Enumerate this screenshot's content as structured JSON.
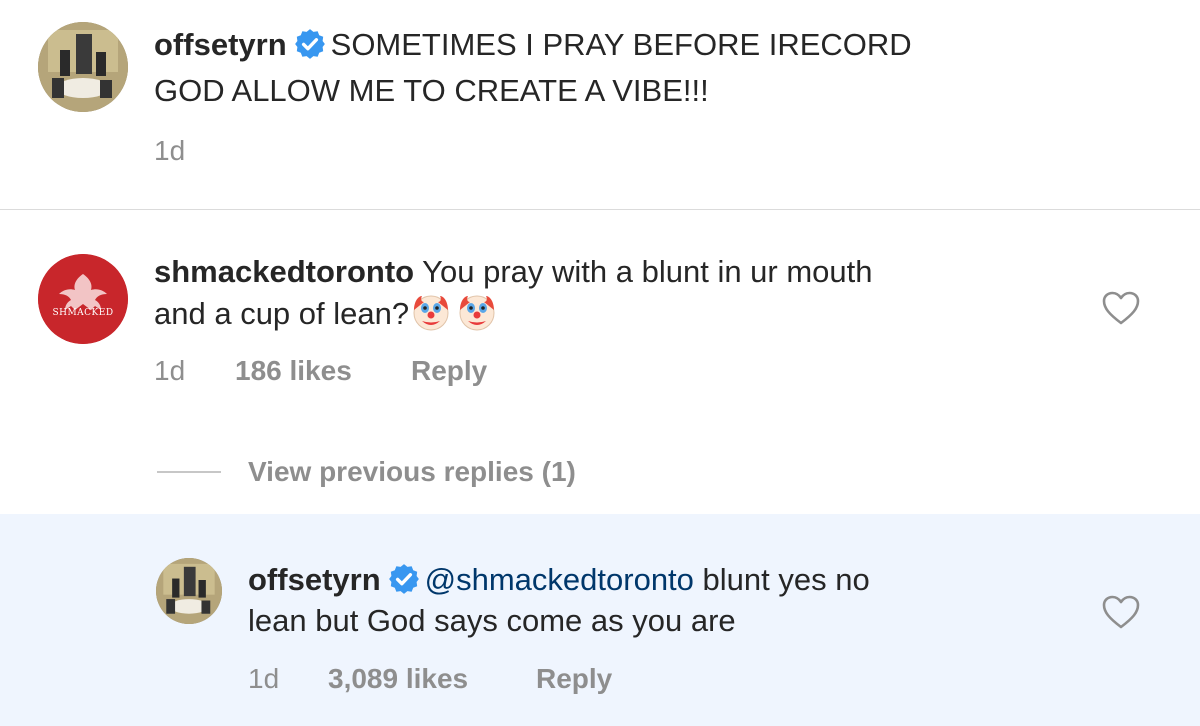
{
  "caption": {
    "username": "offsetyrn",
    "text_line1": "SOMETIMES I PRAY BEFORE IRECORD",
    "text_line2": "GOD ALLOW ME TO CREATE A VIBE!!!",
    "time": "1d"
  },
  "comment": {
    "username": "shmackedtoronto",
    "avatar_text": "SHMACKED",
    "text_line1": "You pray with a blunt in ur mouth",
    "text_line2": "and a cup of lean?",
    "time": "1d",
    "likes": "186 likes",
    "reply_label": "Reply"
  },
  "view_previous": "View previous replies (1)",
  "reply": {
    "username": "offsetyrn",
    "mention": "@shmackedtoronto",
    "text_line1": "blunt yes no",
    "text_line2": "lean but God says come as you are",
    "time": "1d",
    "likes": "3,089 likes",
    "reply_label": "Reply"
  },
  "colors": {
    "verified": "#3897f0",
    "mention": "#00376b",
    "meta": "#8e8e8e",
    "reply_bg": "#eff5fe",
    "avatar_red": "#c8262b"
  }
}
